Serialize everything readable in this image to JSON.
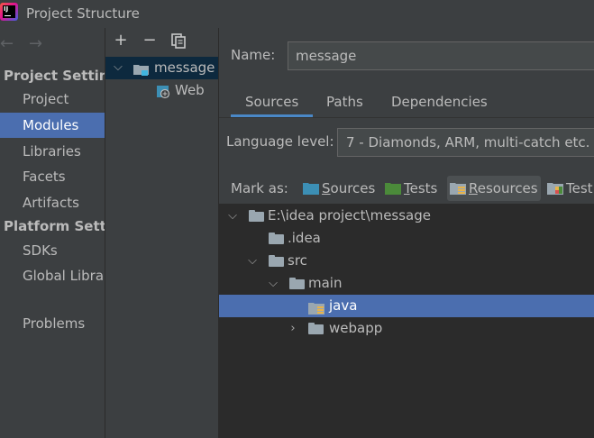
{
  "window": {
    "title": "Project Structure"
  },
  "nav": {
    "back": "←",
    "forward": "→",
    "project_settings_header": "Project Setting",
    "platform_settings_header": "Platform Settin",
    "items": [
      {
        "label": "Project"
      },
      {
        "label": "Modules",
        "selected": true
      },
      {
        "label": "Libraries"
      },
      {
        "label": "Facets"
      },
      {
        "label": "Artifacts"
      },
      {
        "label": "SDKs"
      },
      {
        "label": "Global Librar"
      },
      {
        "label": "Problems"
      }
    ]
  },
  "module_toolbar": {
    "add": "+",
    "remove": "−",
    "copy": "copy"
  },
  "module_tree": {
    "root": {
      "label": "message"
    },
    "child": {
      "label": "Web"
    }
  },
  "module_settings": {
    "name_label": "Name:",
    "name_value": "message",
    "tabs": [
      "Sources",
      "Paths",
      "Dependencies"
    ],
    "active_tab": "Sources",
    "language_level_label": "Language level:",
    "language_level_value": "7 - Diamonds, ARM, multi-catch etc.",
    "mark_as_label": "Mark as:",
    "mark_as": [
      {
        "prefix": "",
        "underlined": "S",
        "rest": "ources",
        "color": "#3c8fb5"
      },
      {
        "prefix": "",
        "underlined": "T",
        "rest": "ests",
        "color": "#4b8a3a"
      },
      {
        "prefix": "",
        "underlined": "R",
        "rest": "esources",
        "color": "#9aa7b0"
      },
      {
        "prefix": "",
        "underlined": "",
        "rest": "Test",
        "color": "#9aa7b0"
      }
    ],
    "source_tree": [
      {
        "label": "E:\\idea project\\message",
        "expanded": true
      },
      {
        "label": ".idea"
      },
      {
        "label": "src",
        "expanded": true
      },
      {
        "label": "main",
        "expanded": true
      },
      {
        "label": "java",
        "selected": true
      },
      {
        "label": "webapp",
        "expanded": false
      }
    ]
  },
  "colors": {
    "background": "#3c3f41",
    "selection": "#4b6eaf",
    "tree_background": "#2b2b2b",
    "tab_accent": "#4a88c7"
  }
}
